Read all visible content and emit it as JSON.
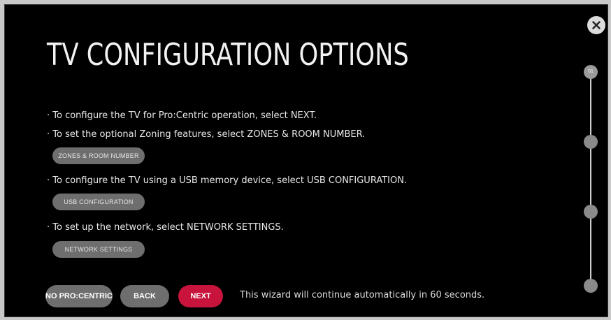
{
  "title": "TV CONFIGURATION OPTIONS",
  "instructions": {
    "line1": "· To configure the TV for Pro:Centric operation, select NEXT.",
    "line2": "· To set the optional Zoning features, select ZONES & ROOM NUMBER.",
    "line3": "· To configure the TV using a USB memory device, select USB CONFIGURATION.",
    "line4": "· To set up the network, select NETWORK SETTINGS."
  },
  "buttons": {
    "zones": "ZONES & ROOM NUMBER",
    "usb": "USB CONFIGURATION",
    "network": "NETWORK SETTINGS",
    "no_procentric": "NO PRO:CENTRIC",
    "back": "BACK",
    "next": "NEXT"
  },
  "wizard_message": "This wizard will continue automatically in 60 seconds.",
  "progress": {
    "current_step_label": "01",
    "total_steps": 4,
    "current_step": 1
  },
  "icons": {
    "close": "close-icon"
  },
  "colors": {
    "background": "#000000",
    "accent_next": "#c8143c",
    "secondary_button": "#6e6e6e",
    "text": "#e8e8e8"
  }
}
